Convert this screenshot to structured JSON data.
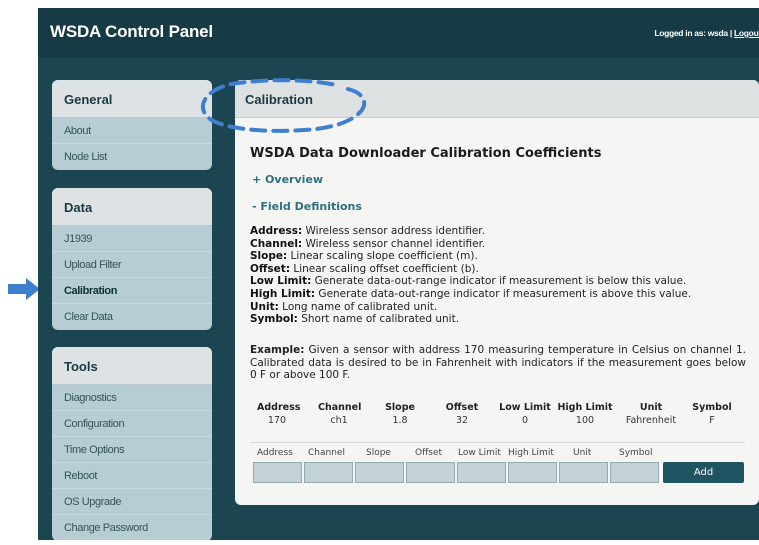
{
  "header": {
    "app_title": "WSDA Control Panel",
    "login_prefix": "Logged in as: wsda |",
    "logout_label": "Logout"
  },
  "sidebar": {
    "general": {
      "title": "General",
      "items": [
        "About",
        "Node List"
      ]
    },
    "data": {
      "title": "Data",
      "items": [
        "J1939",
        "Upload Filter",
        "Calibration",
        "Clear Data"
      ]
    },
    "tools": {
      "title": "Tools",
      "items": [
        "Diagnostics",
        "Configuration",
        "Time Options",
        "Reboot",
        "OS Upgrade",
        "Change Password"
      ]
    }
  },
  "main": {
    "header": "Calibration",
    "title": "WSDA Data Downloader Calibration Coefficients",
    "overview": "+ Overview",
    "field_definitions": "- Field Definitions",
    "definitions": [
      {
        "term": "Address:",
        "desc": " Wireless sensor address identifier."
      },
      {
        "term": "Channel:",
        "desc": " Wireless sensor channel identifier."
      },
      {
        "term": "Slope:",
        "desc": " Linear scaling slope coefficient (m)."
      },
      {
        "term": "Offset:",
        "desc": " Linear scaling offset coefficient (b)."
      },
      {
        "term": "Low Limit:",
        "desc": " Generate data-out-range indicator if measurement is below this value."
      },
      {
        "term": "High Limit:",
        "desc": " Generate data-out-range indicator if measurement is above this value."
      },
      {
        "term": "Unit:",
        "desc": " Long name of calibrated unit."
      },
      {
        "term": "Symbol:",
        "desc": " Short name of calibrated unit."
      }
    ],
    "example_label": "Example:",
    "example_text": " Given a sensor with address 170 measuring temperature in Celsius on channel 1. Calibrated data is desired to be in Fahrenheit with indicators if the measurement goes below 0 F or above 100 F.",
    "example_table": {
      "headers": [
        "Address",
        "Channel",
        "Slope",
        "Offset",
        "Low Limit",
        "High Limit",
        "Unit",
        "Symbol"
      ],
      "values": [
        "170",
        "ch1",
        "1.8",
        "32",
        "0",
        "100",
        "Fahrenheit",
        "F"
      ]
    },
    "form_labels": [
      "Address",
      "Channel",
      "Slope",
      "Offset",
      "Low Limit",
      "High Limit",
      "Unit",
      "Symbol"
    ],
    "add_button": "Add"
  },
  "colors": {
    "frame": "#1b4550",
    "sidebar_item_bg": "#b5cdd3",
    "header_bg": "#dde3e5",
    "annotation_blue": "#3f7fcf",
    "add_button": "#1f5563"
  }
}
